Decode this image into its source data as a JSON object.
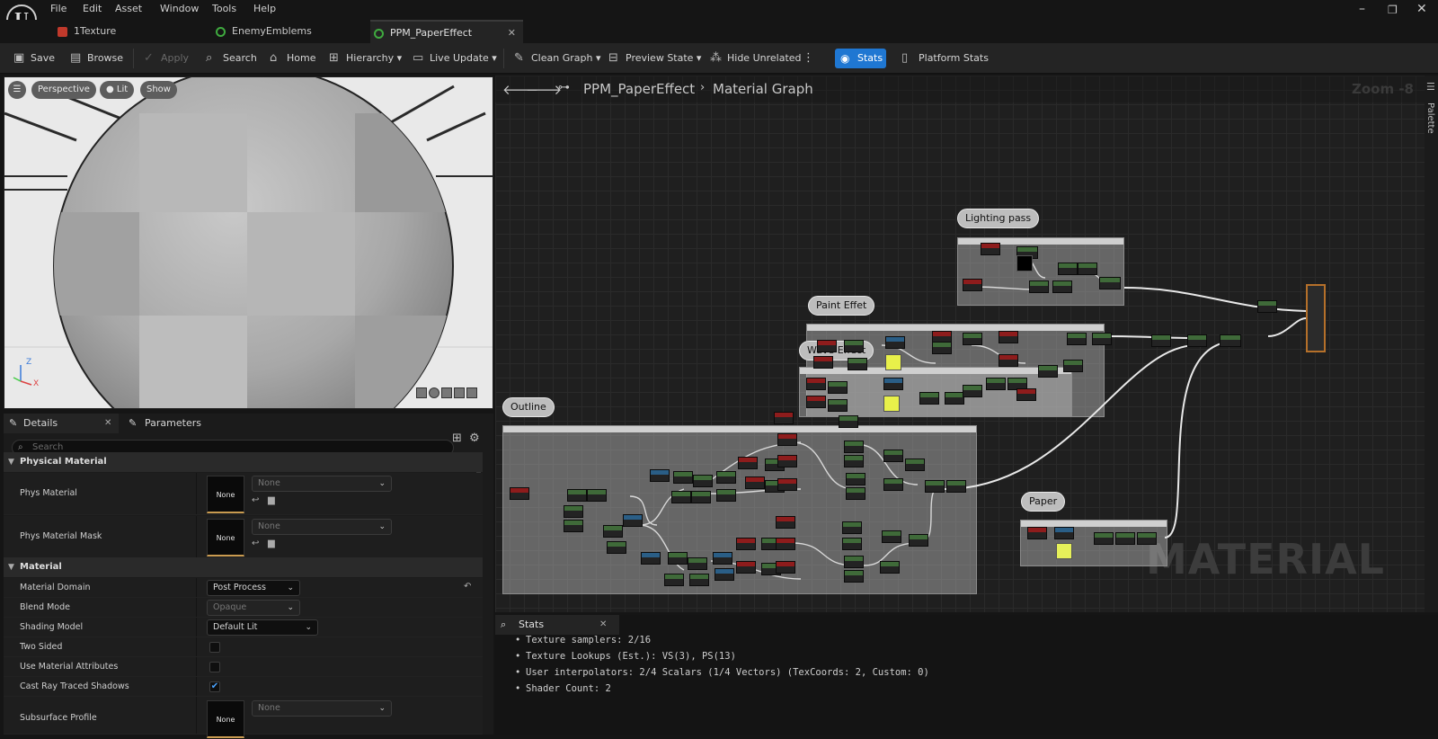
{
  "menu": [
    "File",
    "Edit",
    "Asset",
    "Window",
    "Tools",
    "Help"
  ],
  "logo": "U",
  "tabs": [
    {
      "label": "1Texture",
      "icon": "texture-icon",
      "color": "#c0392b"
    },
    {
      "label": "EnemyEmblems",
      "icon": "material-icon",
      "color": "#3faa3f"
    },
    {
      "label": "PPM_PaperEffect",
      "icon": "material-icon",
      "color": "#3faa3f",
      "active": true
    }
  ],
  "toolbar": {
    "save": "Save",
    "browse": "Browse",
    "apply": "Apply",
    "search": "Search",
    "home": "Home",
    "hierarchy": "Hierarchy",
    "live_update": "Live Update",
    "clean_graph": "Clean Graph",
    "preview_state": "Preview State",
    "hide_unrelated": "Hide Unrelated",
    "stats": "Stats",
    "platform_stats": "Platform Stats"
  },
  "viewport": {
    "perspective": "Perspective",
    "lit": "Lit",
    "show": "Show",
    "axis_z": "Z",
    "axis_x": "X"
  },
  "panel": {
    "details_tab": "Details",
    "parameters_tab": "Parameters",
    "search_placeholder": "Search",
    "categories": {
      "physical": "Physical Material",
      "material": "Material"
    },
    "phys_material": {
      "label": "Phys Material",
      "value": "None",
      "thumb": "None"
    },
    "phys_material_mask": {
      "label": "Phys Material Mask",
      "value": "None",
      "thumb": "None"
    },
    "material_domain": {
      "label": "Material Domain",
      "value": "Post Process"
    },
    "blend_mode": {
      "label": "Blend Mode",
      "value": "Opaque"
    },
    "shading_model": {
      "label": "Shading Model",
      "value": "Default Lit"
    },
    "two_sided": {
      "label": "Two Sided",
      "checked": false
    },
    "use_material_attributes": {
      "label": "Use Material Attributes",
      "checked": false
    },
    "cast_ray_traced_shadows": {
      "label": "Cast Ray Traced Shadows",
      "checked": true
    },
    "subsurface_profile": {
      "label": "Subsurface Profile",
      "value": "None",
      "thumb": "None"
    }
  },
  "graph": {
    "crumb_asset": "PPM_PaperEffect",
    "crumb_graph": "Material Graph",
    "zoom": "Zoom -8",
    "watermark": "MATERIAL",
    "comments": {
      "lighting": "Lighting pass",
      "paint": "Paint Effet",
      "wave": "Wave Effect",
      "outline": "Outline",
      "paper": "Paper"
    },
    "palette": "Palette"
  },
  "stats": {
    "tab": "Stats",
    "lines": [
      "Texture samplers: 2/16",
      "Texture Lookups (Est.): VS(3), PS(13)",
      "User interpolators: 2/4 Scalars (1/4 Vectors) (TexCoords: 2, Custom: 0)",
      "Shader Count: 2"
    ]
  }
}
